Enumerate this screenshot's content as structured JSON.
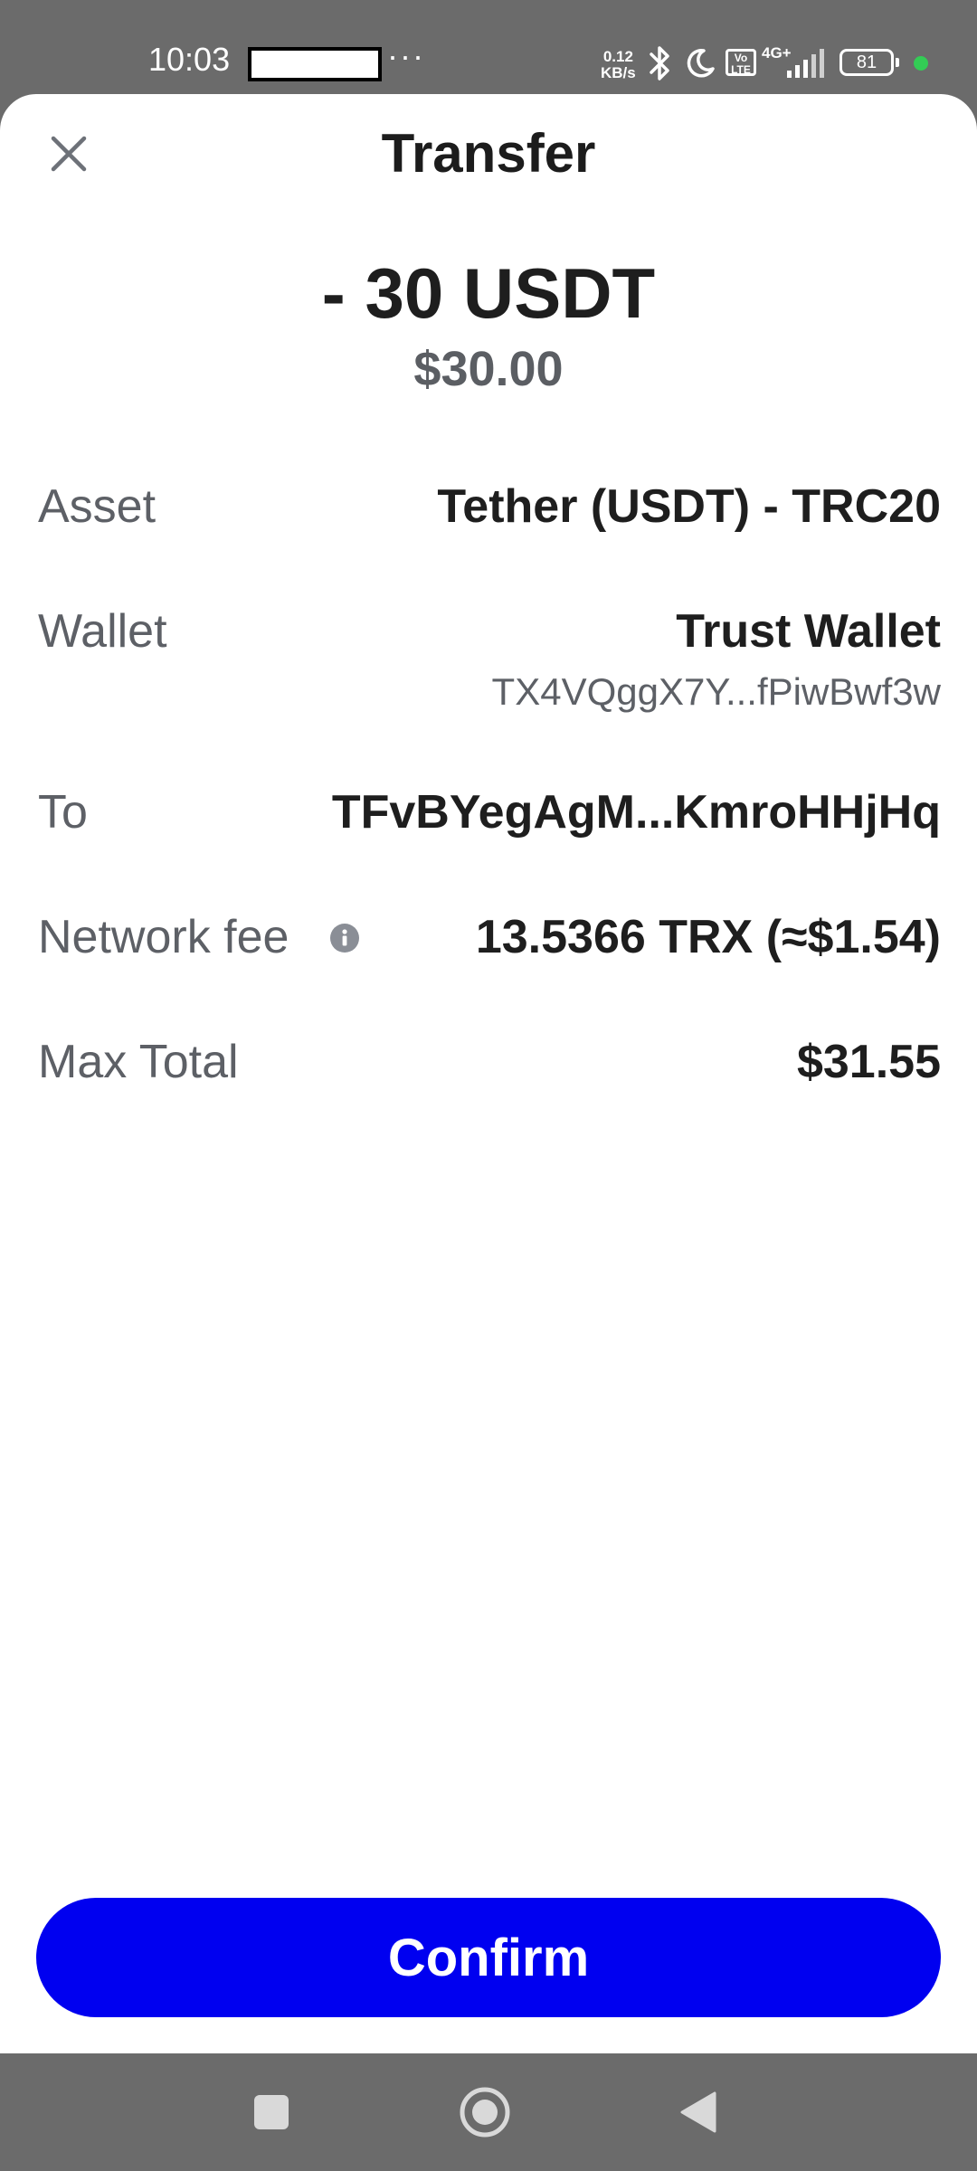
{
  "status_bar": {
    "time": "10:03",
    "more": "···",
    "net_speed_value": "0.12",
    "net_speed_unit": "KB/s",
    "volte_line1": "Vo",
    "volte_line2": "LTE",
    "network": "4G+",
    "battery": "81",
    "icons": [
      "bluetooth-icon",
      "moon-icon",
      "signal-icon",
      "battery-icon"
    ],
    "dot_color": "#33cc55"
  },
  "sheet": {
    "title": "Transfer",
    "amount": "- 30 USDT",
    "amount_fiat": "$30.00"
  },
  "details": {
    "asset_label": "Asset",
    "asset_value": "Tether (USDT) - TRC20",
    "wallet_label": "Wallet",
    "wallet_name": "Trust Wallet",
    "wallet_address": "TX4VQggX7Y...fPiwBwf3w",
    "to_label": "To",
    "to_value": "TFvBYegAgM...KmroHHjHq",
    "fee_label": "Network fee",
    "fee_value": "13.5366 TRX (≈$1.54)",
    "total_label": "Max Total",
    "total_value": "$31.55"
  },
  "actions": {
    "confirm_label": "Confirm",
    "confirm_color": "#0000f0"
  },
  "nav_bar": {
    "icons": [
      "recent-apps-icon",
      "home-icon",
      "back-icon"
    ]
  }
}
